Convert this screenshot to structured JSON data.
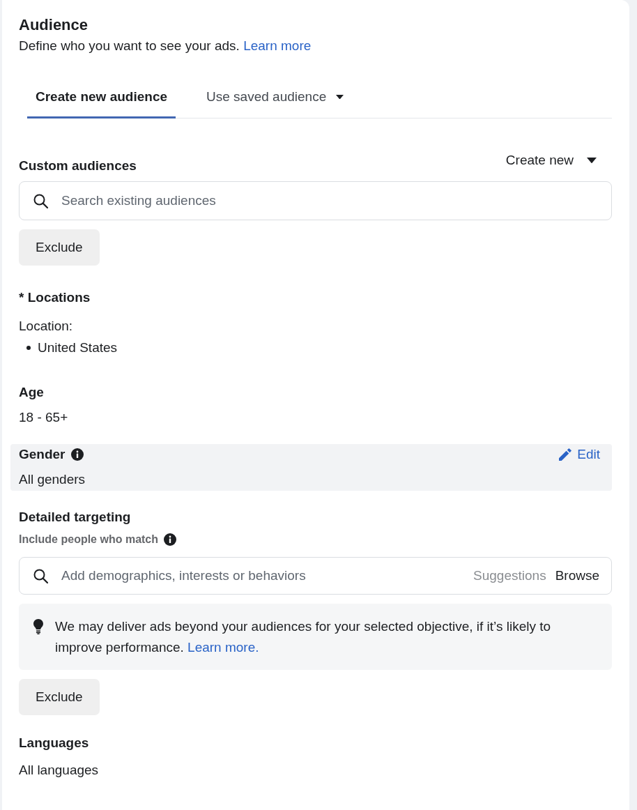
{
  "header": {
    "title": "Audience",
    "description": "Define who you want to see your ads.",
    "link": "Learn more"
  },
  "tabs": [
    {
      "label": "Create new audience",
      "selected": true,
      "has_menu": false
    },
    {
      "label": "Use saved audience",
      "selected": false,
      "has_menu": true
    }
  ],
  "custom_audiences": {
    "label": "Custom audiences",
    "create_button": "Create new",
    "search": {
      "placeholder": "Search existing audiences"
    },
    "exclude_button": "Exclude"
  },
  "locations": {
    "label": "* Locations",
    "sub_label": "Location:",
    "items": [
      "United States"
    ]
  },
  "age": {
    "label": "Age",
    "value": "18 - 65+"
  },
  "gender": {
    "label": "Gender",
    "value": "All genders",
    "edit": "Edit",
    "highlighted": true
  },
  "detailed_targeting": {
    "label": "Detailed targeting",
    "sub_label": "Include people who match",
    "search": {
      "placeholder": "Add demographics, interests or behaviors"
    },
    "field_actions": [
      {
        "label": "Suggestions",
        "disabled": true
      },
      {
        "label": "Browse",
        "disabled": false
      }
    ],
    "notice": {
      "text": "We may deliver ads beyond your audiences for your selected objective, if it’s likely to improve performance.",
      "link": "Learn more."
    },
    "exclude_button": "Exclude"
  },
  "languages": {
    "label": "Languages",
    "value": "All languages"
  }
}
